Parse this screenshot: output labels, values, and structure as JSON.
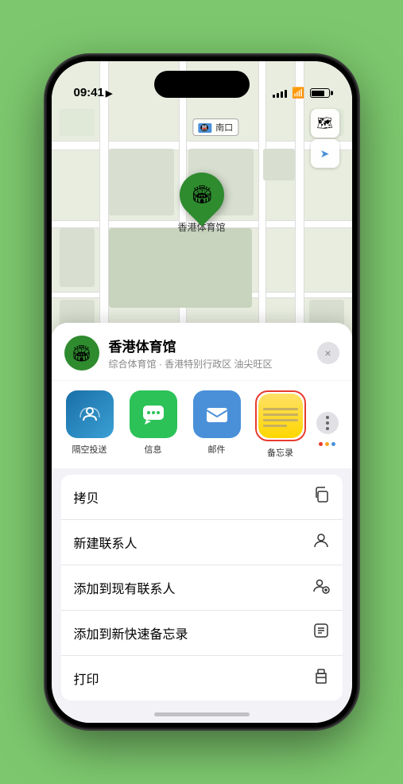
{
  "statusBar": {
    "time": "09:41",
    "timeArrow": "▶"
  },
  "map": {
    "label": "南口",
    "pinLabel": "香港体育馆"
  },
  "mapControls": {
    "mapBtn": "🗺",
    "locationBtn": "➤"
  },
  "sheet": {
    "venueName": "香港体育馆",
    "venueDesc": "综合体育馆 · 香港特别行政区 油尖旺区",
    "closeLabel": "×"
  },
  "shareItems": [
    {
      "id": "airdrop",
      "label": "隔空投送"
    },
    {
      "id": "messages",
      "label": "信息"
    },
    {
      "id": "mail",
      "label": "邮件"
    },
    {
      "id": "notes",
      "label": "备忘录"
    }
  ],
  "actions": [
    {
      "label": "拷贝",
      "icon": "copy"
    },
    {
      "label": "新建联系人",
      "icon": "person"
    },
    {
      "label": "添加到现有联系人",
      "icon": "person-add"
    },
    {
      "label": "添加到新快速备忘录",
      "icon": "note"
    },
    {
      "label": "打印",
      "icon": "print"
    }
  ]
}
